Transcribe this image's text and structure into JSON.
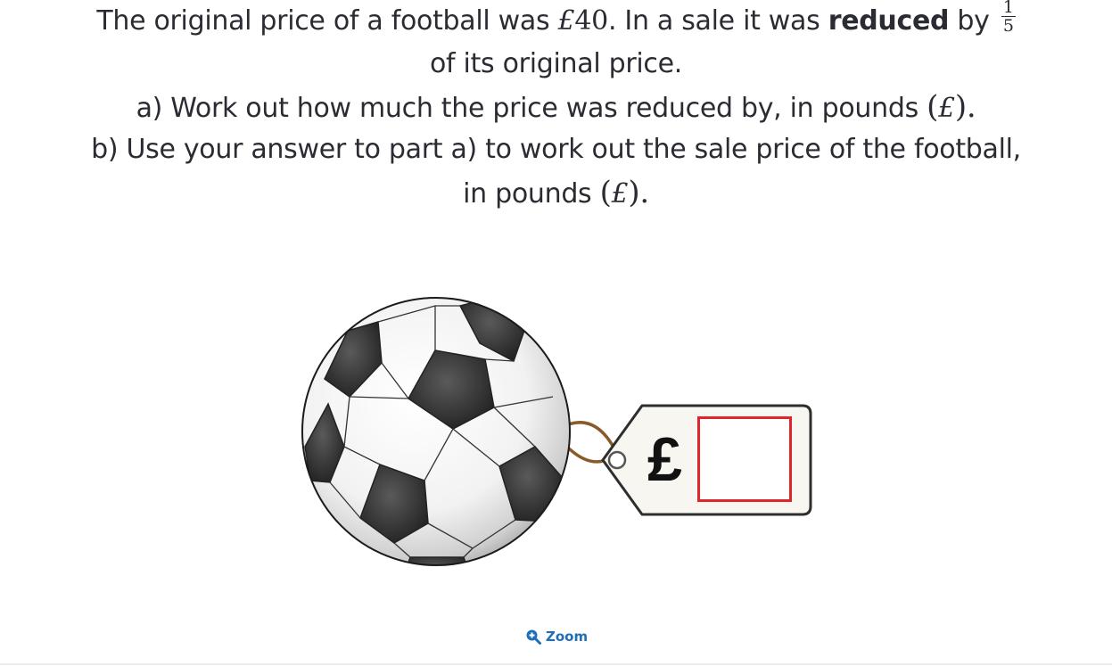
{
  "question": {
    "line1": {
      "text_a": "The original price of a football was ",
      "price_symbol": "£",
      "price_value": "40",
      "text_b": ". In a sale it was ",
      "emphasis": "reduced",
      "text_c": " by",
      "fraction_numerator": "1",
      "fraction_denominator": "5"
    },
    "line2": "of its original price.",
    "line3": {
      "text": "a) Work out how much the price was reduced by, in pounds ",
      "open_paren": "(",
      "symbol": "£",
      "close": ")."
    },
    "line4": "b) Use your answer to part a) to work out the sale price of the football,",
    "line5": {
      "text": "in pounds ",
      "open_paren": "(",
      "symbol": "£",
      "close": ")."
    }
  },
  "price_tag": {
    "currency_symbol": "£",
    "answer_value": ""
  },
  "zoom": {
    "label": "Zoom",
    "icon": "zoom-in-icon"
  },
  "colors": {
    "text": "#2b2b33",
    "answer_box_border": "#e0242c",
    "zoom_blue": "#1f6fb8",
    "tag_fill": "#f7f6f1",
    "string": "#8a5a2b"
  }
}
